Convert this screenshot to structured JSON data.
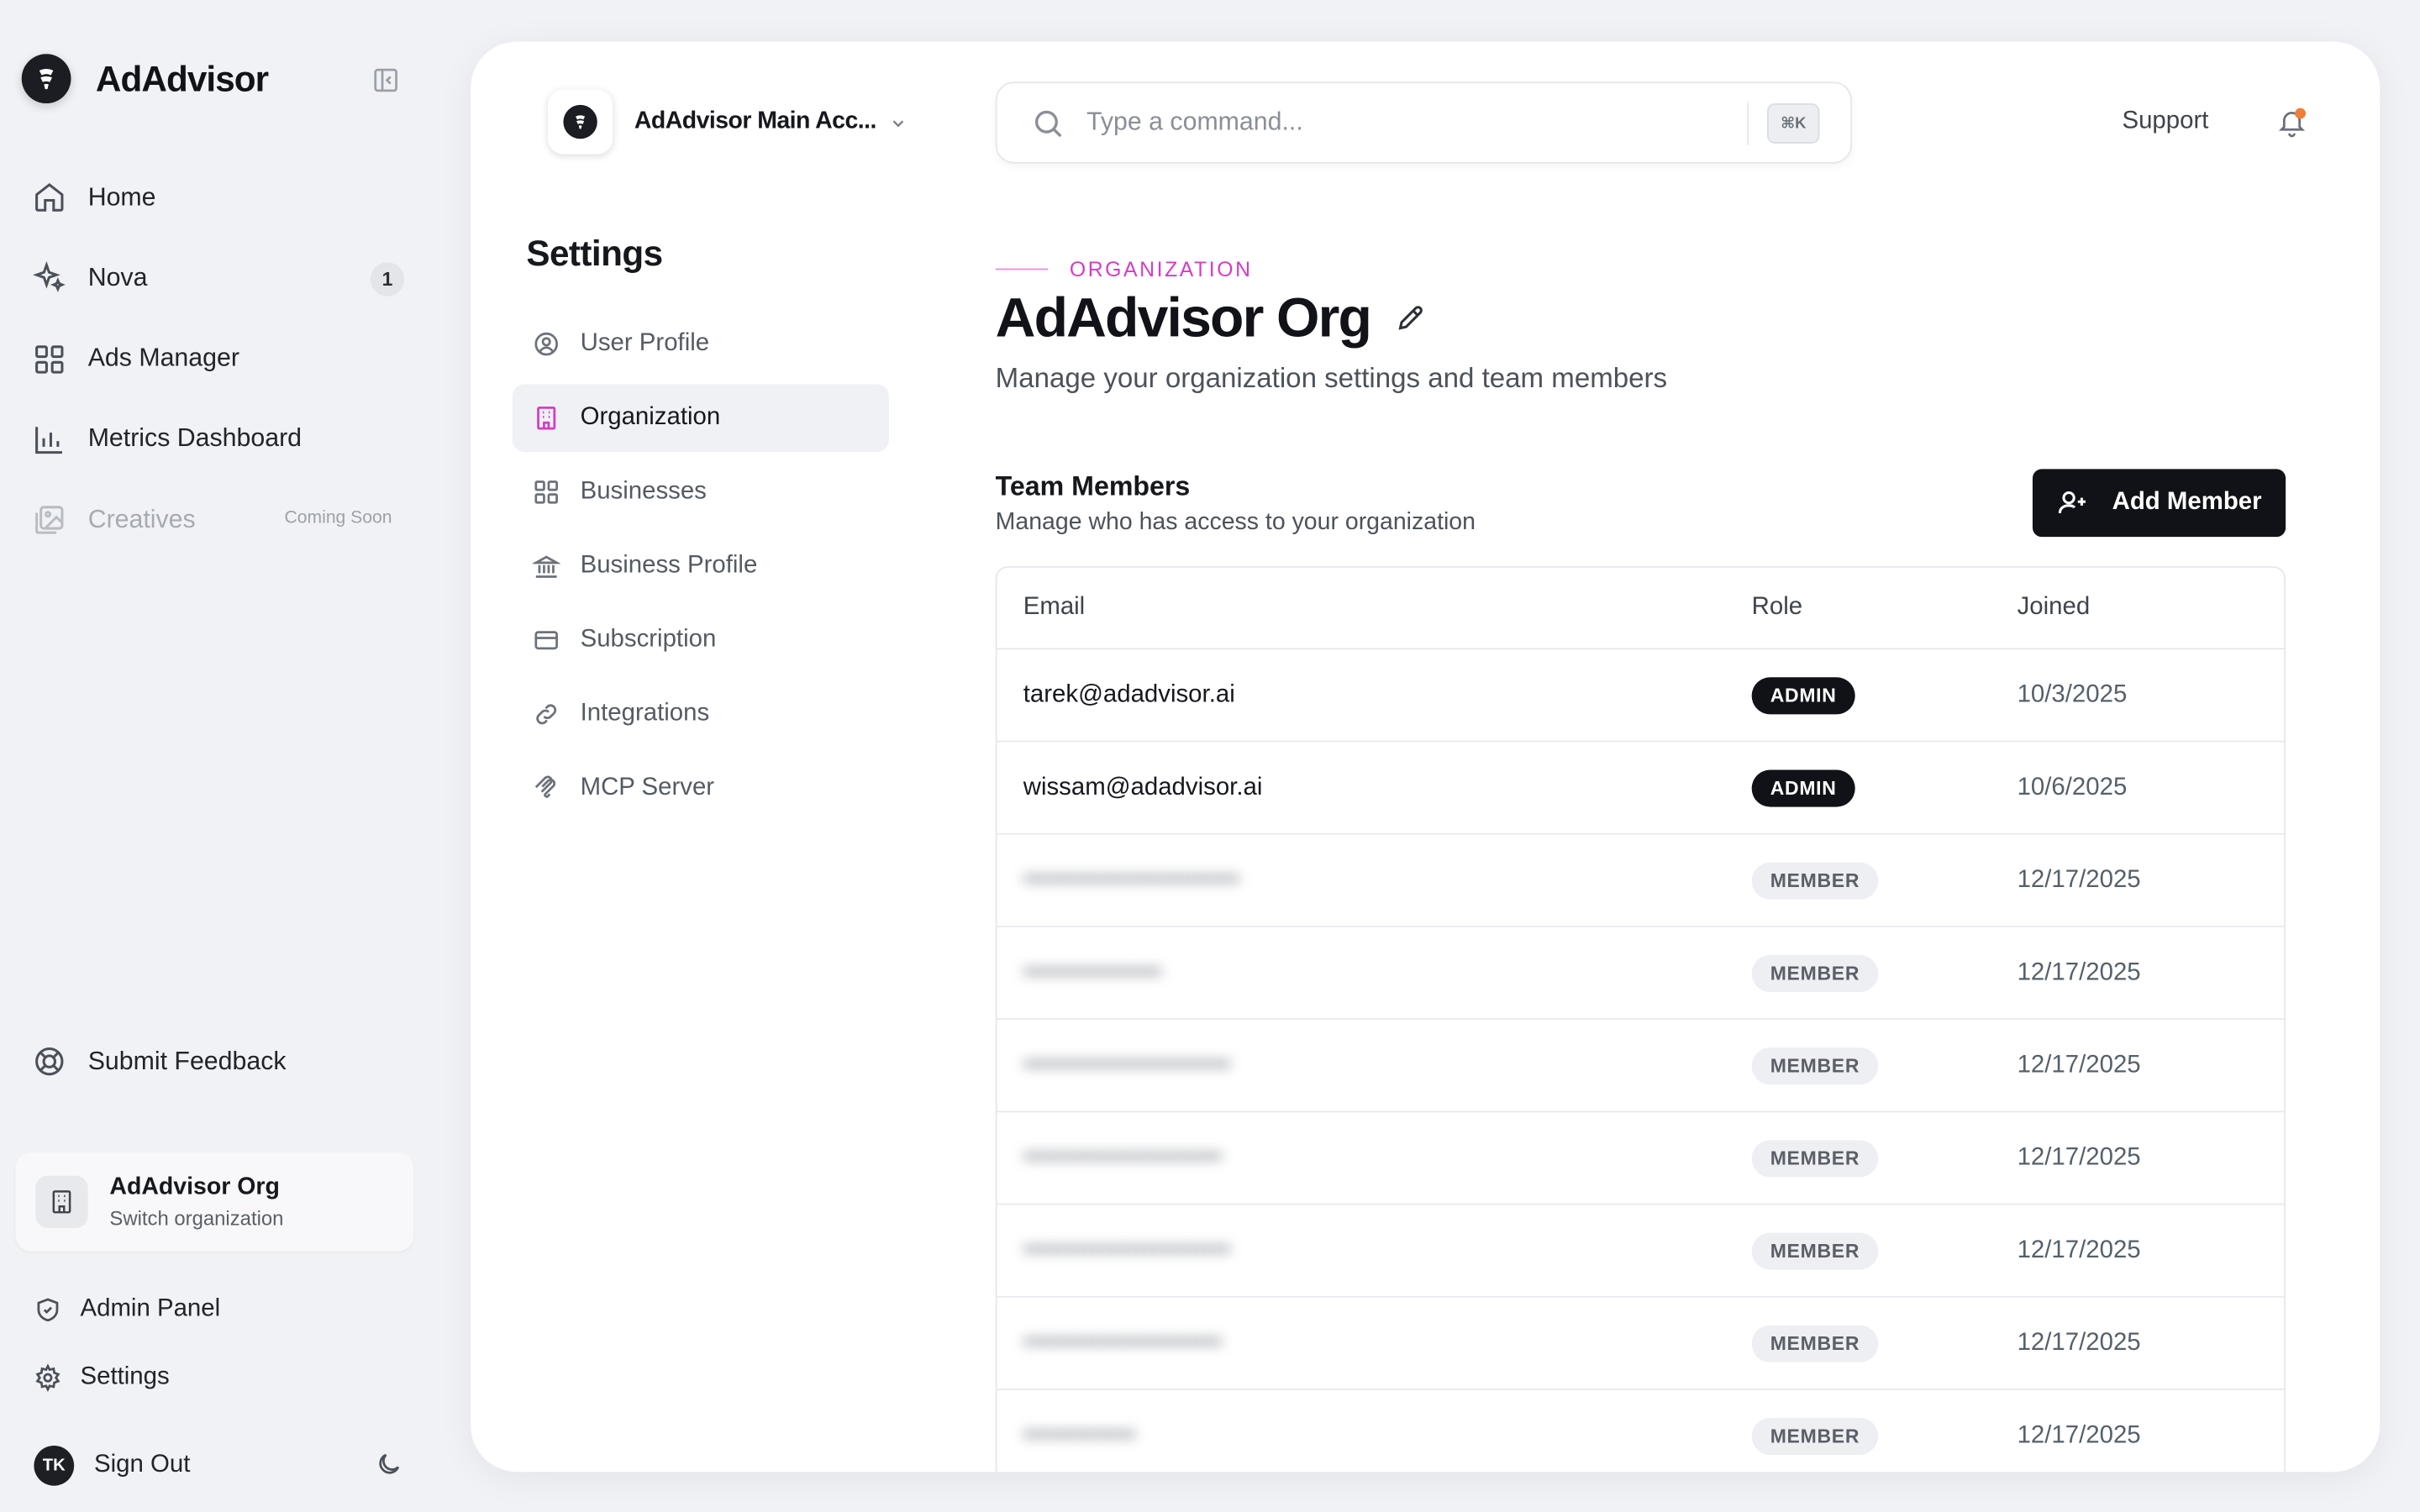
{
  "brand": {
    "name": "AdAdvisor"
  },
  "sidebar": {
    "items": [
      {
        "label": "Home",
        "icon": "home-icon"
      },
      {
        "label": "Nova",
        "icon": "sparkle-icon",
        "badge": "1"
      },
      {
        "label": "Ads Manager",
        "icon": "grid-icon"
      },
      {
        "label": "Metrics Dashboard",
        "icon": "bar-chart-icon"
      },
      {
        "label": "Creatives",
        "icon": "image-icon",
        "tag": "Coming Soon",
        "disabled": true
      }
    ],
    "feedback_label": "Submit Feedback",
    "org_card": {
      "name": "AdAdvisor Org",
      "sub": "Switch organization"
    },
    "admin_label": "Admin Panel",
    "settings_label": "Settings",
    "signout_label": "Sign Out",
    "avatar_initials": "TK"
  },
  "header": {
    "account_name": "AdAdvisor Main Acc...",
    "search_placeholder": "Type a command...",
    "shortcut": "⌘K",
    "support_label": "Support"
  },
  "settings_nav": {
    "title": "Settings",
    "items": [
      {
        "label": "User Profile",
        "icon": "user-circle-icon"
      },
      {
        "label": "Organization",
        "icon": "building-icon",
        "active": true
      },
      {
        "label": "Businesses",
        "icon": "grid-icon"
      },
      {
        "label": "Business Profile",
        "icon": "bank-icon"
      },
      {
        "label": "Subscription",
        "icon": "credit-card-icon"
      },
      {
        "label": "Integrations",
        "icon": "link-icon"
      },
      {
        "label": "MCP Server",
        "icon": "mcp-icon"
      }
    ]
  },
  "main": {
    "eyebrow": "ORGANIZATION",
    "title": "AdAdvisor Org",
    "description": "Manage your organization settings and team members",
    "team": {
      "title": "Team Members",
      "subtitle": "Manage who has access to your organization",
      "add_label": "Add Member",
      "columns": [
        "Email",
        "Role",
        "Joined"
      ],
      "rows": [
        {
          "email": "tarek@adadvisor.ai",
          "role": "ADMIN",
          "joined": "10/3/2025",
          "blurred": false
        },
        {
          "email": "wissam@adadvisor.ai",
          "role": "ADMIN",
          "joined": "10/6/2025",
          "blurred": false
        },
        {
          "email": "•••••••••••••••••••••••••",
          "role": "MEMBER",
          "joined": "12/17/2025",
          "blurred": true
        },
        {
          "email": "••••••••••••••••",
          "role": "MEMBER",
          "joined": "12/17/2025",
          "blurred": true
        },
        {
          "email": "••••••••••••••••••••••••",
          "role": "MEMBER",
          "joined": "12/17/2025",
          "blurred": true
        },
        {
          "email": "•••••••••••••••••••••••",
          "role": "MEMBER",
          "joined": "12/17/2025",
          "blurred": true
        },
        {
          "email": "••••••••••••••••••••••••",
          "role": "MEMBER",
          "joined": "12/17/2025",
          "blurred": true
        },
        {
          "email": "•••••••••••••••••••••••",
          "role": "MEMBER",
          "joined": "12/17/2025",
          "blurred": true
        },
        {
          "email": "•••••••••••••",
          "role": "MEMBER",
          "joined": "12/17/2025",
          "blurred": true
        }
      ]
    }
  },
  "colors": {
    "accent": "#d43cc8",
    "primary_button": "#111217",
    "notification_dot": "#f07d3a"
  }
}
